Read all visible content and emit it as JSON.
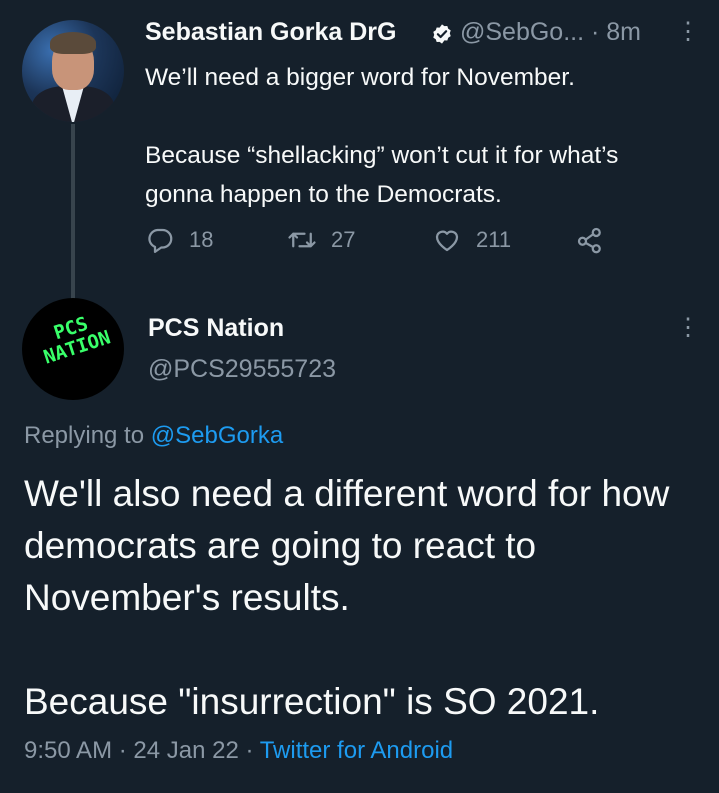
{
  "tweet": {
    "author_name": "Sebastian Gorka DrG",
    "handle_time": "@SebGo... · 8m",
    "line1": "We’ll need a bigger word for November.",
    "line2": "Because “shellacking” won’t cut it for what’s gonna happen to the Democrats.",
    "reply_count": "18",
    "retweet_count": "27",
    "like_count": "211",
    "icons": {
      "reply": "reply-icon",
      "retweet": "retweet-icon",
      "like": "heart-icon",
      "share": "share-icon",
      "more": "more-vertical-icon",
      "verified": "verified-badge-icon"
    }
  },
  "reply": {
    "author_name": "PCS Nation",
    "handle": "@PCS29555723",
    "avatar_text": "PCS NATION",
    "replying_prefix": "Replying to",
    "replying_mention": "@SebGorka",
    "paragraph1": "We'll also need a different word for how democrats are going to react to November's results.",
    "paragraph2": "Because \"insurrection\" is SO 2021.",
    "timestamp": "9:50 AM · 24 Jan 22 · ",
    "source": "Twitter for Android"
  },
  "colors": {
    "background": "#15202b",
    "text": "#f7f9f9",
    "muted": "#8b98a5",
    "accent": "#1d9bf0",
    "logo_green": "#39ff6a"
  }
}
